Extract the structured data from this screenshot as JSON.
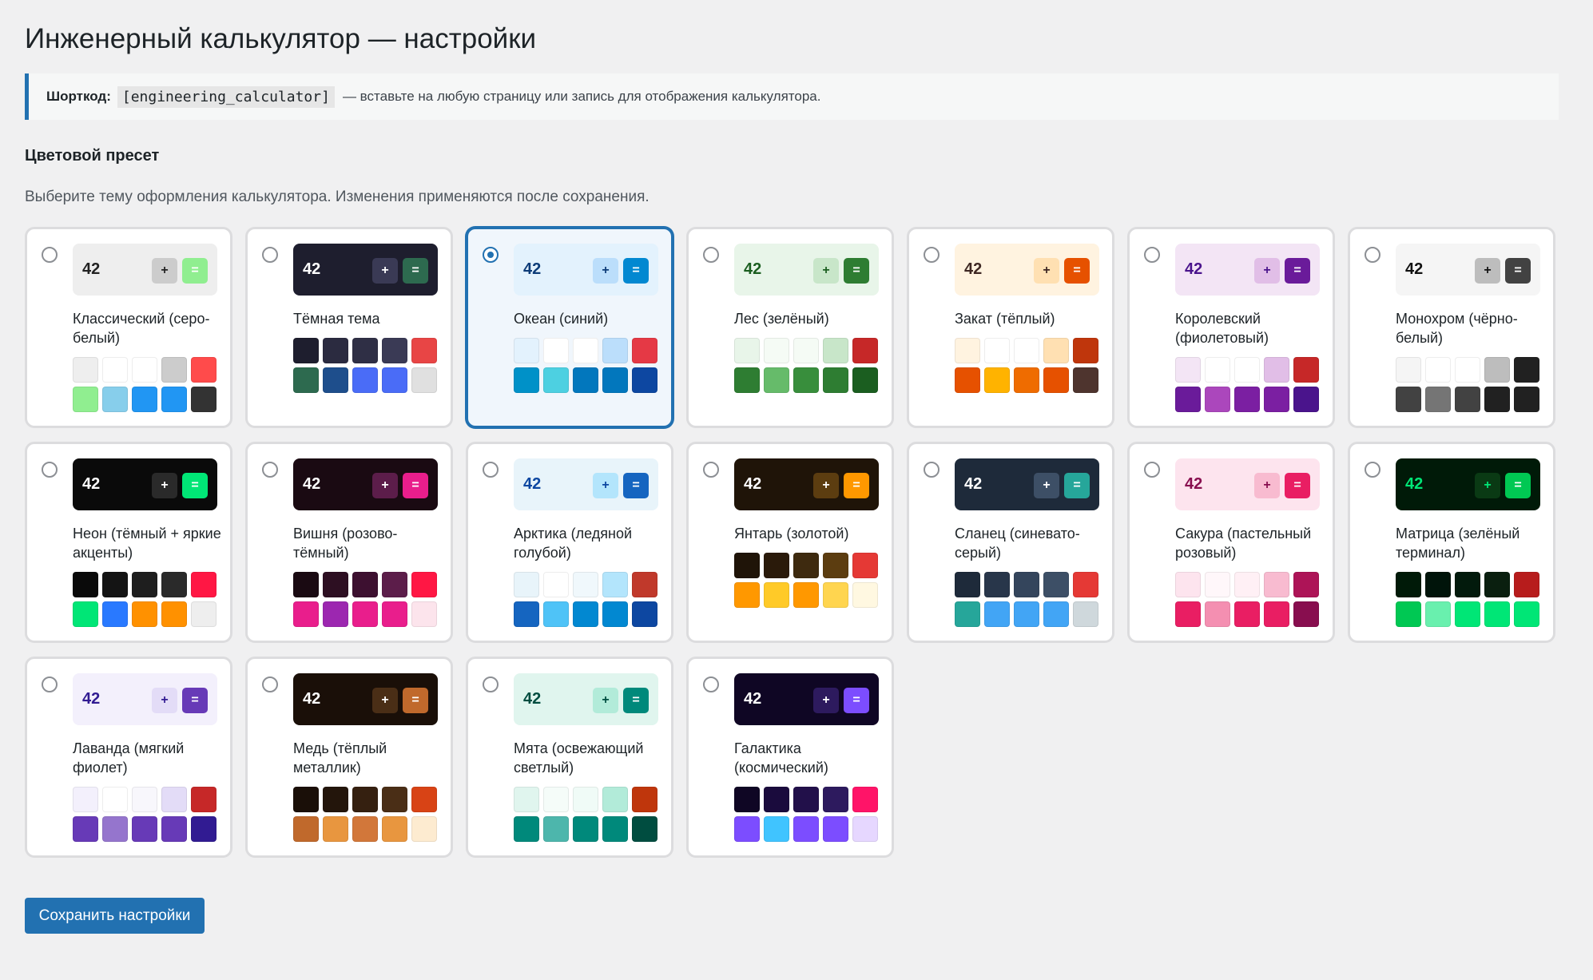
{
  "page_title": "Инженерный калькулятор — настройки",
  "notice": {
    "label": "Шорткод:",
    "code": "[engineering_calculator]",
    "text": "— вставьте на любую страницу или запись для отображения калькулятора."
  },
  "section": {
    "title": "Цветовой пресет",
    "description": "Выберите тему оформления калькулятора. Изменения применяются после сохранения."
  },
  "save_label": "Сохранить настройки",
  "selected_preset": "ocean",
  "presets": [
    {
      "id": "classic",
      "name": "Классический (серо-белый)",
      "selected": false,
      "preview": {
        "number": "42",
        "bg": "#eeeeee",
        "num_color": "#222222",
        "plus_label": "+",
        "plus_bg": "#cccccc",
        "plus_fg": "#222222",
        "eq_label": "=",
        "eq_bg": "#90ee90",
        "eq_fg": "#ffffff"
      },
      "swatches": [
        "#eeeeee",
        "#ffffff",
        "#ffffff",
        "#cccccc",
        "#ff4b4b",
        "#90ee90",
        "#87ceeb",
        "#2196f3",
        "#2196f3",
        "#333333"
      ]
    },
    {
      "id": "dark",
      "name": "Тёмная тема",
      "selected": false,
      "preview": {
        "number": "42",
        "bg": "#1e1e2e",
        "num_color": "#ffffff",
        "plus_label": "+",
        "plus_bg": "#3a3a55",
        "plus_fg": "#ffffff",
        "eq_label": "=",
        "eq_bg": "#2d6a4f",
        "eq_fg": "#ffffff"
      },
      "swatches": [
        "#1e1e2e",
        "#2b2b40",
        "#2f2f45",
        "#3a3a55",
        "#e84545",
        "#2d6a4f",
        "#1e4e8c",
        "#4a6cf7",
        "#4a6cf7",
        "#e0e0e0"
      ]
    },
    {
      "id": "ocean",
      "name": "Океан (синий)",
      "selected": true,
      "preview": {
        "number": "42",
        "bg": "#e3f2fd",
        "num_color": "#0d3c78",
        "plus_label": "+",
        "plus_bg": "#bbdefb",
        "plus_fg": "#0d3c78",
        "eq_label": "=",
        "eq_bg": "#0288d1",
        "eq_fg": "#ffffff"
      },
      "swatches": [
        "#e3f2fd",
        "#ffffff",
        "#ffffff",
        "#bbdefb",
        "#e53945",
        "#0091c8",
        "#4dd0e1",
        "#0277bd",
        "#0277bd",
        "#0d47a1"
      ]
    },
    {
      "id": "forest",
      "name": "Лес (зелёный)",
      "selected": false,
      "preview": {
        "number": "42",
        "bg": "#e8f5e9",
        "num_color": "#1b5e20",
        "plus_label": "+",
        "plus_bg": "#c8e6c9",
        "plus_fg": "#1b5e20",
        "eq_label": "=",
        "eq_bg": "#2e7d32",
        "eq_fg": "#ffffff"
      },
      "swatches": [
        "#e8f5e9",
        "#f5fbf5",
        "#f5fbf5",
        "#c8e6c9",
        "#c62828",
        "#2e7d32",
        "#66bb6a",
        "#388e3c",
        "#2e7d32",
        "#1b5e20"
      ]
    },
    {
      "id": "sunset",
      "name": "Закат (тёплый)",
      "selected": false,
      "preview": {
        "number": "42",
        "bg": "#fff3e0",
        "num_color": "#3e2723",
        "plus_label": "+",
        "plus_bg": "#ffe0b2",
        "plus_fg": "#3e2723",
        "eq_label": "=",
        "eq_bg": "#e65100",
        "eq_fg": "#ffffff"
      },
      "swatches": [
        "#fff3e0",
        "#ffffff",
        "#ffffff",
        "#ffe0b2",
        "#bf360c",
        "#e65100",
        "#ffb300",
        "#ef6c00",
        "#e65100",
        "#4e342e"
      ]
    },
    {
      "id": "royal",
      "name": "Королевский (фиолетовый)",
      "selected": false,
      "preview": {
        "number": "42",
        "bg": "#f3e5f5",
        "num_color": "#4a148c",
        "plus_label": "+",
        "plus_bg": "#e1bee7",
        "plus_fg": "#4a148c",
        "eq_label": "=",
        "eq_bg": "#6a1b9a",
        "eq_fg": "#ffffff"
      },
      "swatches": [
        "#f3e5f5",
        "#ffffff",
        "#ffffff",
        "#e1bee7",
        "#c62828",
        "#6a1b9a",
        "#ab47bc",
        "#7b1fa2",
        "#7b1fa2",
        "#4a148c"
      ]
    },
    {
      "id": "mono",
      "name": "Монохром (чёрно-белый)",
      "selected": false,
      "preview": {
        "number": "42",
        "bg": "#f5f5f5",
        "num_color": "#111111",
        "plus_label": "+",
        "plus_bg": "#bdbdbd",
        "plus_fg": "#111111",
        "eq_label": "=",
        "eq_bg": "#424242",
        "eq_fg": "#ffffff"
      },
      "swatches": [
        "#f5f5f5",
        "#ffffff",
        "#ffffff",
        "#bdbdbd",
        "#212121",
        "#424242",
        "#757575",
        "#424242",
        "#212121",
        "#212121"
      ]
    },
    {
      "id": "neon",
      "name": "Неон (тёмный + яркие акценты)",
      "selected": false,
      "preview": {
        "number": "42",
        "bg": "#0a0a0a",
        "num_color": "#ffffff",
        "plus_label": "+",
        "plus_bg": "#2a2a2a",
        "plus_fg": "#ffffff",
        "eq_label": "=",
        "eq_bg": "#00e676",
        "eq_fg": "#ffffff"
      },
      "swatches": [
        "#0a0a0a",
        "#141414",
        "#1e1e1e",
        "#2a2a2a",
        "#ff1744",
        "#00e676",
        "#2979ff",
        "#ff9100",
        "#ff9100",
        "#eeeeee"
      ]
    },
    {
      "id": "cherry",
      "name": "Вишня (розово-тёмный)",
      "selected": false,
      "preview": {
        "number": "42",
        "bg": "#1a0a12",
        "num_color": "#ffffff",
        "plus_label": "+",
        "plus_bg": "#5c1d4a",
        "plus_fg": "#ffffff",
        "eq_label": "=",
        "eq_bg": "#e91e8c",
        "eq_fg": "#ffffff"
      },
      "swatches": [
        "#1a0a12",
        "#2d0f22",
        "#3d1030",
        "#5c1d4a",
        "#ff1744",
        "#e91e8c",
        "#9c27b0",
        "#e91e8c",
        "#e91e8c",
        "#fce4ec"
      ]
    },
    {
      "id": "arctic",
      "name": "Арктика (ледяной голубой)",
      "selected": false,
      "preview": {
        "number": "42",
        "bg": "#e8f4fa",
        "num_color": "#0d47a1",
        "plus_label": "+",
        "plus_bg": "#b3e5fc",
        "plus_fg": "#0d47a1",
        "eq_label": "=",
        "eq_bg": "#1565c0",
        "eq_fg": "#ffffff"
      },
      "swatches": [
        "#e8f4fa",
        "#ffffff",
        "#f0f8fc",
        "#b3e5fc",
        "#c0392b",
        "#1565c0",
        "#4fc3f7",
        "#0288d1",
        "#0288d1",
        "#0d47a1"
      ]
    },
    {
      "id": "amber",
      "name": "Янтарь (золотой)",
      "selected": false,
      "preview": {
        "number": "42",
        "bg": "#1f1408",
        "num_color": "#ffffff",
        "plus_label": "+",
        "plus_bg": "#5c3d10",
        "plus_fg": "#ffffff",
        "eq_label": "=",
        "eq_bg": "#ff9800",
        "eq_fg": "#ffffff"
      },
      "swatches": [
        "#1f1408",
        "#2a1a0a",
        "#3e2a0f",
        "#5c3d10",
        "#e53935",
        "#ff9800",
        "#ffca28",
        "#ff9800",
        "#ffd54f",
        "#fff8e1"
      ]
    },
    {
      "id": "slate",
      "name": "Сланец (синевато-серый)",
      "selected": false,
      "preview": {
        "number": "42",
        "bg": "#1e2a3a",
        "num_color": "#ffffff",
        "plus_label": "+",
        "plus_bg": "#3d4f66",
        "plus_fg": "#ffffff",
        "eq_label": "=",
        "eq_bg": "#26a69a",
        "eq_fg": "#ffffff"
      },
      "swatches": [
        "#1e2a3a",
        "#28364a",
        "#34455c",
        "#3d4f66",
        "#e53935",
        "#26a69a",
        "#42a5f5",
        "#42a5f5",
        "#42a5f5",
        "#cfd8dc"
      ]
    },
    {
      "id": "sakura",
      "name": "Сакура (пастельный розовый)",
      "selected": false,
      "preview": {
        "number": "42",
        "bg": "#fde4ee",
        "num_color": "#880e4f",
        "plus_label": "+",
        "plus_bg": "#f8bbd0",
        "plus_fg": "#880e4f",
        "eq_label": "=",
        "eq_bg": "#e91e63",
        "eq_fg": "#ffffff"
      },
      "swatches": [
        "#fde4ee",
        "#fff7fa",
        "#fff0f5",
        "#f8bbd0",
        "#ad1457",
        "#e91e63",
        "#f48fb1",
        "#e91e63",
        "#e91e63",
        "#880e4f"
      ]
    },
    {
      "id": "matrix",
      "name": "Матрица (зелёный терминал)",
      "selected": false,
      "preview": {
        "number": "42",
        "bg": "#001a08",
        "num_color": "#00e676",
        "plus_label": "+",
        "plus_bg": "#0a3a14",
        "plus_fg": "#00e676",
        "eq_label": "=",
        "eq_bg": "#00c853",
        "eq_fg": "#ffffff"
      },
      "swatches": [
        "#001a08",
        "#00140a",
        "#021a0c",
        "#0a1f0f",
        "#b71c1c",
        "#00c853",
        "#69f0ae",
        "#00e676",
        "#00e676",
        "#00e676"
      ]
    },
    {
      "id": "lavender",
      "name": "Лаванда (мягкий фиолет)",
      "selected": false,
      "preview": {
        "number": "42",
        "bg": "#f3f0fc",
        "num_color": "#311b92",
        "plus_label": "+",
        "plus_bg": "#e3dcf7",
        "plus_fg": "#311b92",
        "eq_label": "=",
        "eq_bg": "#673ab7",
        "eq_fg": "#ffffff"
      },
      "swatches": [
        "#f3f0fc",
        "#ffffff",
        "#f8f7fc",
        "#e3dcf7",
        "#c62828",
        "#673ab7",
        "#9575cd",
        "#673ab7",
        "#673ab7",
        "#311b92"
      ]
    },
    {
      "id": "copper",
      "name": "Медь (тёплый металлик)",
      "selected": false,
      "preview": {
        "number": "42",
        "bg": "#1a0f08",
        "num_color": "#ffffff",
        "plus_label": "+",
        "plus_bg": "#4a2e16",
        "plus_fg": "#ffffff",
        "eq_label": "=",
        "eq_bg": "#c0692c",
        "eq_fg": "#ffffff"
      },
      "swatches": [
        "#1a0f08",
        "#23150b",
        "#352010",
        "#4a2e16",
        "#d84315",
        "#c0692c",
        "#e8963f",
        "#d2773a",
        "#e8963f",
        "#fdebd0"
      ]
    },
    {
      "id": "mint",
      "name": "Мята (освежающий светлый)",
      "selected": false,
      "preview": {
        "number": "42",
        "bg": "#e0f5ee",
        "num_color": "#004d40",
        "plus_label": "+",
        "plus_bg": "#b2ebd9",
        "plus_fg": "#004d40",
        "eq_label": "=",
        "eq_bg": "#00897b",
        "eq_fg": "#ffffff"
      },
      "swatches": [
        "#e0f5ee",
        "#f5fcf9",
        "#f0fbf7",
        "#b2ebd9",
        "#bf360c",
        "#00897b",
        "#4db6ac",
        "#00897b",
        "#00897b",
        "#004d40"
      ]
    },
    {
      "id": "galaxy",
      "name": "Галактика (космический)",
      "selected": false,
      "preview": {
        "number": "42",
        "bg": "#0f0624",
        "num_color": "#ffffff",
        "plus_label": "+",
        "plus_bg": "#2d1a5e",
        "plus_fg": "#ffffff",
        "eq_label": "=",
        "eq_bg": "#7c4dff",
        "eq_fg": "#ffffff"
      },
      "swatches": [
        "#0f0624",
        "#1a0b3d",
        "#22104a",
        "#2d1a5e",
        "#ff1468",
        "#7c4dff",
        "#40c4ff",
        "#7c4dff",
        "#7c4dff",
        "#e6d7ff"
      ]
    }
  ]
}
